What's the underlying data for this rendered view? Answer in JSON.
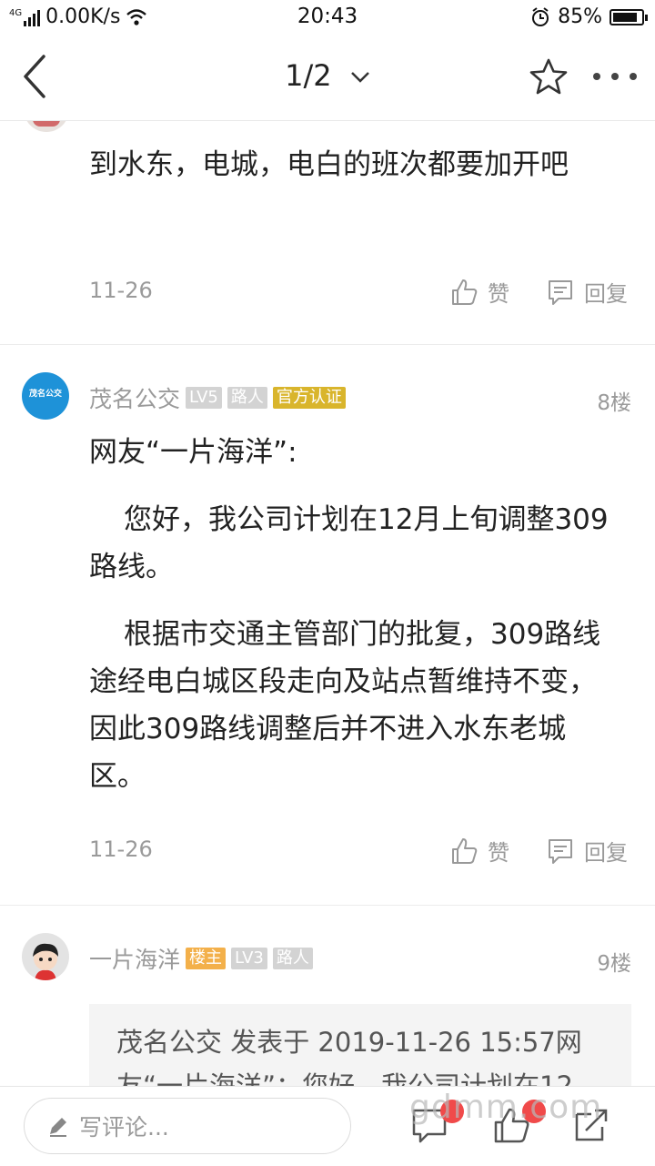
{
  "status_bar": {
    "network": "4G",
    "speed": "0.00K/s",
    "time": "20:43",
    "battery": "85%",
    "battery_level": 0.85
  },
  "nav": {
    "page_indicator": "1/2"
  },
  "posts": [
    {
      "text": "到水东，电城，电白的班次都要加开吧",
      "time": "11-26",
      "like_label": "赞",
      "reply_label": "回复"
    },
    {
      "author": "茂名公交",
      "avatar_text": "茂名公交",
      "badges": [
        "LV5",
        "路人",
        "官方认证"
      ],
      "floor": "8楼",
      "paragraphs": [
        "网友“一片海洋”:",
        "您好，我公司计划在12月上旬调整309路线。",
        "根据市交通主管部门的批复，309路线途经电白城区段走向及站点暂维持不变，因此309路线调整后并不进入水东老城区。"
      ],
      "time": "11-26",
      "like_label": "赞",
      "reply_label": "回复"
    },
    {
      "author": "一片海洋",
      "badges": [
        "楼主",
        "LV3",
        "路人"
      ],
      "floor": "9楼",
      "quote": "茂名公交 发表于 2019-11-26 15:57网友“一片海洋”：您好，我公司计划在12"
    }
  ],
  "bottom_bar": {
    "comment_placeholder": "写评论..."
  },
  "watermark": "gdmm.com",
  "colors": {
    "official_badge": "#d9b52c",
    "op_badge": "#f3b04a",
    "notification_dot": "#f04a4a"
  }
}
